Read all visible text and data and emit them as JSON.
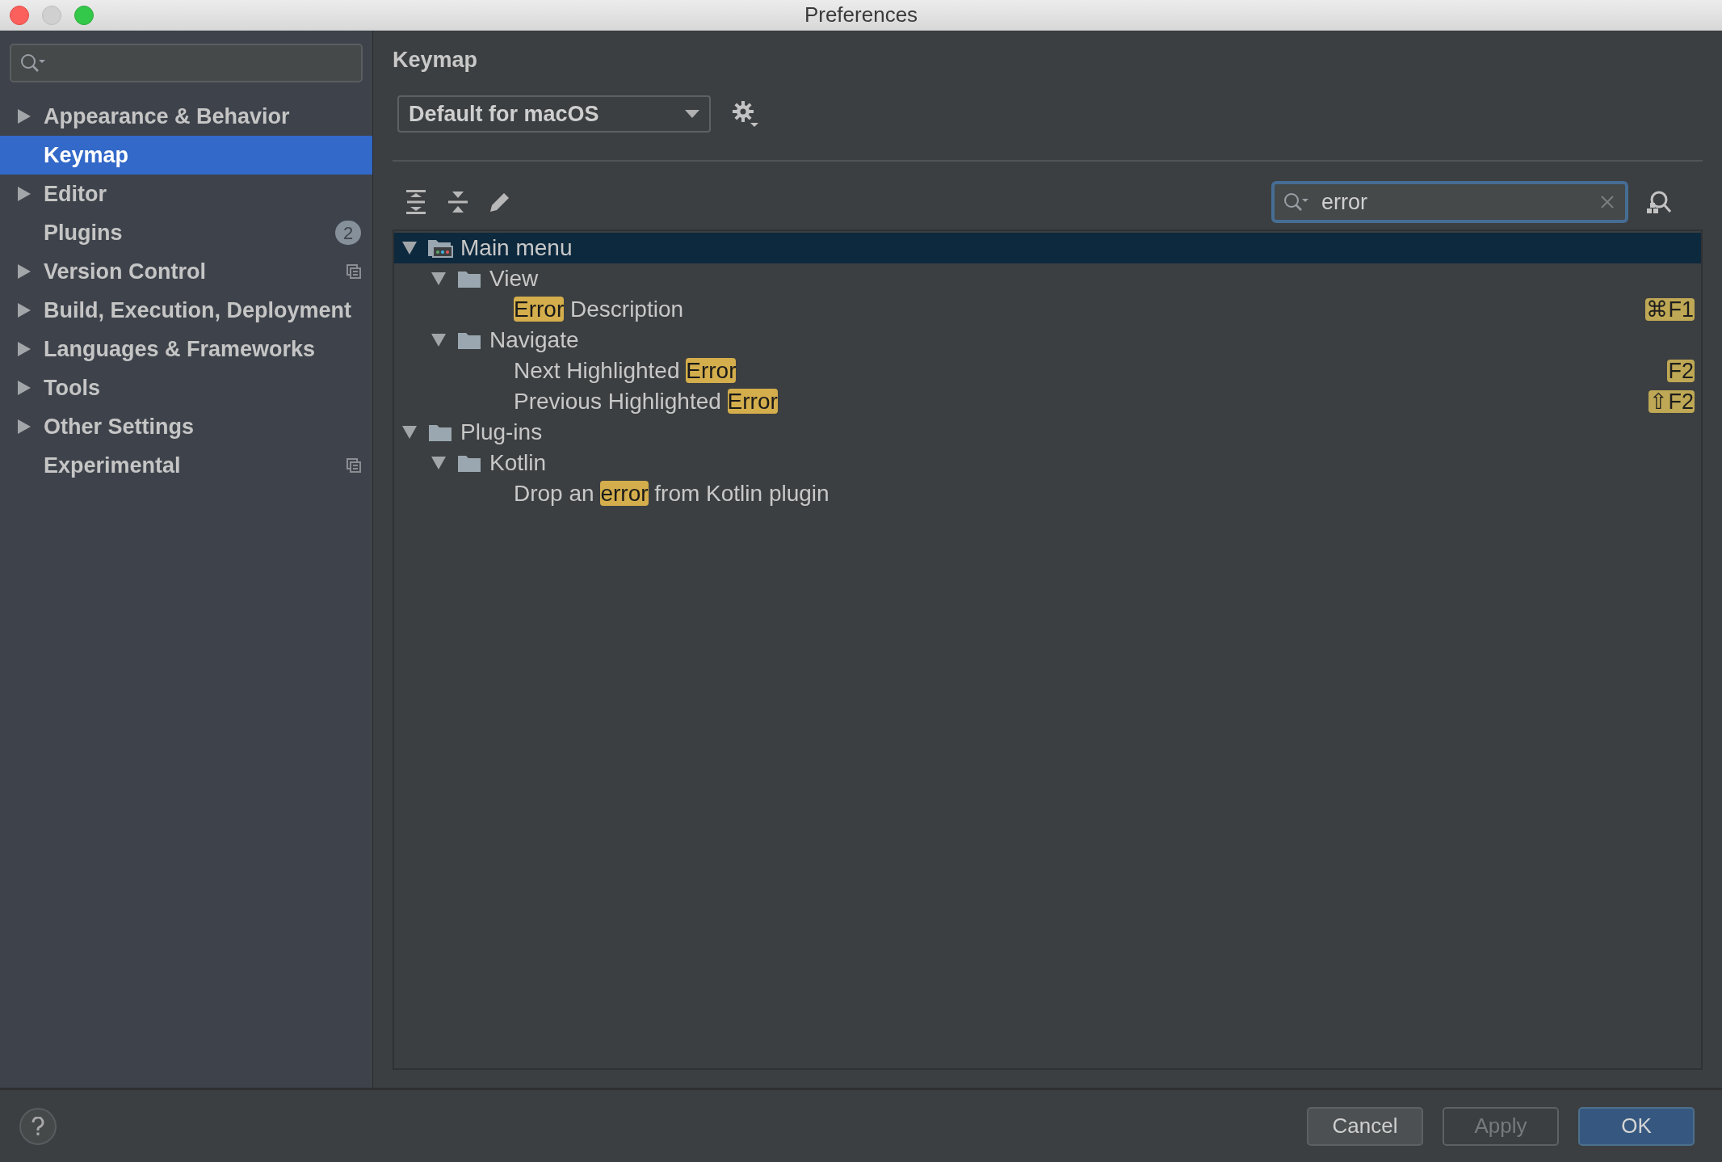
{
  "window": {
    "title": "Preferences"
  },
  "sidebar": {
    "items": [
      {
        "label": "Appearance & Behavior",
        "expandable": true,
        "selected": false,
        "project_icon": false
      },
      {
        "label": "Keymap",
        "expandable": false,
        "selected": true,
        "project_icon": false
      },
      {
        "label": "Editor",
        "expandable": true,
        "selected": false,
        "project_icon": false
      },
      {
        "label": "Plugins",
        "expandable": false,
        "selected": false,
        "project_icon": false,
        "badge": "2"
      },
      {
        "label": "Version Control",
        "expandable": true,
        "selected": false,
        "project_icon": true
      },
      {
        "label": "Build, Execution, Deployment",
        "expandable": true,
        "selected": false,
        "project_icon": false
      },
      {
        "label": "Languages & Frameworks",
        "expandable": true,
        "selected": false,
        "project_icon": false
      },
      {
        "label": "Tools",
        "expandable": true,
        "selected": false,
        "project_icon": false
      },
      {
        "label": "Other Settings",
        "expandable": true,
        "selected": false,
        "project_icon": false
      },
      {
        "label": "Experimental",
        "expandable": false,
        "selected": false,
        "project_icon": true
      }
    ]
  },
  "header": "Keymap",
  "keymap_select": {
    "value": "Default for macOS"
  },
  "search": {
    "value": "error"
  },
  "tree": [
    {
      "kind": "menu",
      "label": [
        {
          "text": "Main menu",
          "match": false
        }
      ],
      "expanded": true,
      "selected": true,
      "children": [
        {
          "kind": "folder",
          "label": [
            {
              "text": "View",
              "match": false
            }
          ],
          "expanded": true,
          "selected": false,
          "children": [
            {
              "kind": "action",
              "label": [
                {
                  "text": "Error",
                  "match": true
                },
                {
                  "text": " Description",
                  "match": false
                }
              ],
              "selected": false,
              "shortcut": "⌘F1"
            }
          ]
        },
        {
          "kind": "folder",
          "label": [
            {
              "text": "Navigate",
              "match": false
            }
          ],
          "expanded": true,
          "selected": false,
          "children": [
            {
              "kind": "action",
              "label": [
                {
                  "text": "Next Highlighted ",
                  "match": false
                },
                {
                  "text": "Error",
                  "match": true
                }
              ],
              "selected": false,
              "shortcut": "F2"
            },
            {
              "kind": "action",
              "label": [
                {
                  "text": "Previous Highlighted ",
                  "match": false
                },
                {
                  "text": "Error",
                  "match": true
                }
              ],
              "selected": false,
              "shortcut": "⇧F2"
            }
          ]
        }
      ]
    },
    {
      "kind": "folder",
      "label": [
        {
          "text": "Plug-ins",
          "match": false
        }
      ],
      "expanded": true,
      "selected": false,
      "children": [
        {
          "kind": "folder",
          "label": [
            {
              "text": "Kotlin",
              "match": false
            }
          ],
          "expanded": true,
          "selected": false,
          "children": [
            {
              "kind": "action",
              "label": [
                {
                  "text": "Drop an ",
                  "match": false
                },
                {
                  "text": "error",
                  "match": true
                },
                {
                  "text": " from Kotlin plugin",
                  "match": false
                }
              ],
              "selected": false
            }
          ]
        }
      ]
    }
  ],
  "buttons": [
    {
      "label": "Cancel",
      "disabled": false,
      "default": false
    },
    {
      "label": "Apply",
      "disabled": true,
      "default": false
    },
    {
      "label": "OK",
      "disabled": false,
      "default": true
    }
  ]
}
